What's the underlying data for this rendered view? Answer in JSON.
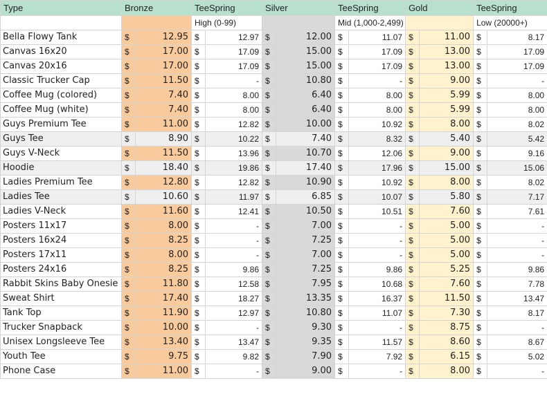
{
  "headers": {
    "type": "Type",
    "bronze": "Bronze",
    "teespring1": "TeeSpring",
    "silver": "Silver",
    "teespring2": "TeeSpring",
    "gold": "Gold",
    "teespring3": "TeeSpring"
  },
  "subheaders": {
    "teespring1": "High (0-99)",
    "teespring2": "Mid (1,000-2,499)",
    "teespring3": "Low (20000+)"
  },
  "currency": "$",
  "rows": [
    {
      "type": "Bella Flowy Tank",
      "bronze": "12.95",
      "ts1": "12.97",
      "silver": "12.00",
      "ts2": "11.07",
      "gold": "11.00",
      "ts3": "8.17",
      "plain": false
    },
    {
      "type": "Canvas 16x20",
      "bronze": "17.00",
      "ts1": "17.09",
      "silver": "15.00",
      "ts2": "17.09",
      "gold": "13.00",
      "ts3": "17.09",
      "plain": false
    },
    {
      "type": "Canvas 20x16",
      "bronze": "17.00",
      "ts1": "17.09",
      "silver": "15.00",
      "ts2": "17.09",
      "gold": "13.00",
      "ts3": "17.09",
      "plain": false
    },
    {
      "type": "Classic Trucker Cap",
      "bronze": "11.50",
      "ts1": "-",
      "silver": "10.80",
      "ts2": "-",
      "gold": "9.00",
      "ts3": "-",
      "plain": false
    },
    {
      "type": "Coffee Mug (colored)",
      "bronze": "7.40",
      "ts1": "8.00",
      "silver": "6.40",
      "ts2": "8.00",
      "gold": "5.99",
      "ts3": "8.00",
      "plain": false
    },
    {
      "type": "Coffee Mug (white)",
      "bronze": "7.40",
      "ts1": "8.00",
      "silver": "6.40",
      "ts2": "8.00",
      "gold": "5.99",
      "ts3": "8.00",
      "plain": false
    },
    {
      "type": "Guys Premium Tee",
      "bronze": "11.00",
      "ts1": "12.82",
      "silver": "10.00",
      "ts2": "10.92",
      "gold": "8.00",
      "ts3": "8.02",
      "plain": false
    },
    {
      "type": "Guys Tee",
      "bronze": "8.90",
      "ts1": "10.22",
      "silver": "7.40",
      "ts2": "8.32",
      "gold": "5.40",
      "ts3": "5.42",
      "plain": true
    },
    {
      "type": "Guys V-Neck",
      "bronze": "11.50",
      "ts1": "13.96",
      "silver": "10.70",
      "ts2": "12.06",
      "gold": "9.00",
      "ts3": "9.16",
      "plain": false
    },
    {
      "type": "Hoodie",
      "bronze": "18.40",
      "ts1": "19.86",
      "silver": "17.40",
      "ts2": "17.96",
      "gold": "15.00",
      "ts3": "15.06",
      "plain": true
    },
    {
      "type": "Ladies Premium Tee",
      "bronze": "12.80",
      "ts1": "12.82",
      "silver": "10.90",
      "ts2": "10.92",
      "gold": "8.00",
      "ts3": "8.02",
      "plain": false
    },
    {
      "type": "Ladies Tee",
      "bronze": "10.60",
      "ts1": "11.97",
      "silver": "6.85",
      "ts2": "10.07",
      "gold": "5.80",
      "ts3": "7.17",
      "plain": true
    },
    {
      "type": "Ladies V-Neck",
      "bronze": "11.60",
      "ts1": "12.41",
      "silver": "10.50",
      "ts2": "10.51",
      "gold": "7.60",
      "ts3": "7.61",
      "plain": false
    },
    {
      "type": "Posters 11x17",
      "bronze": "8.00",
      "ts1": "-",
      "silver": "7.00",
      "ts2": "-",
      "gold": "5.00",
      "ts3": "-",
      "plain": false
    },
    {
      "type": "Posters 16x24",
      "bronze": "8.25",
      "ts1": "-",
      "silver": "7.25",
      "ts2": "-",
      "gold": "5.00",
      "ts3": "-",
      "plain": false
    },
    {
      "type": "Posters 17x11",
      "bronze": "8.00",
      "ts1": "-",
      "silver": "7.00",
      "ts2": "-",
      "gold": "5.00",
      "ts3": "-",
      "plain": false
    },
    {
      "type": "Posters 24x16",
      "bronze": "8.25",
      "ts1": "9.86",
      "silver": "7.25",
      "ts2": "9.86",
      "gold": "5.25",
      "ts3": "9.86",
      "plain": false
    },
    {
      "type": "Rabbit Skins Baby Onesie",
      "bronze": "11.80",
      "ts1": "12.58",
      "silver": "7.95",
      "ts2": "10.68",
      "gold": "7.60",
      "ts3": "7.78",
      "plain": false
    },
    {
      "type": "Sweat Shirt",
      "bronze": "17.40",
      "ts1": "18.27",
      "silver": "13.35",
      "ts2": "16.37",
      "gold": "11.50",
      "ts3": "13.47",
      "plain": false
    },
    {
      "type": "Tank Top",
      "bronze": "11.90",
      "ts1": "12.97",
      "silver": "10.80",
      "ts2": "11.07",
      "gold": "7.30",
      "ts3": "8.17",
      "plain": false
    },
    {
      "type": "Trucker Snapback",
      "bronze": "10.00",
      "ts1": "-",
      "silver": "9.30",
      "ts2": "-",
      "gold": "8.75",
      "ts3": "-",
      "plain": false
    },
    {
      "type": "Unisex Longsleeve Tee",
      "bronze": "13.40",
      "ts1": "13.47",
      "silver": "9.35",
      "ts2": "11.57",
      "gold": "8.60",
      "ts3": "8.67",
      "plain": false
    },
    {
      "type": "Youth Tee",
      "bronze": "9.75",
      "ts1": "9.82",
      "silver": "7.90",
      "ts2": "7.92",
      "gold": "6.15",
      "ts3": "5.02",
      "plain": false
    },
    {
      "type": "Phone Case",
      "bronze": "11.00",
      "ts1": "-",
      "silver": "9.00",
      "ts2": "-",
      "gold": "8.00",
      "ts3": "-",
      "plain": false
    }
  ],
  "colors": {
    "header": "#b7e1cd",
    "bronze": "#f9cb9c",
    "silver": "#d9d9d9",
    "gold": "#fff2cc",
    "plain_row": "#efefef",
    "grid": "#d4d4d4"
  }
}
